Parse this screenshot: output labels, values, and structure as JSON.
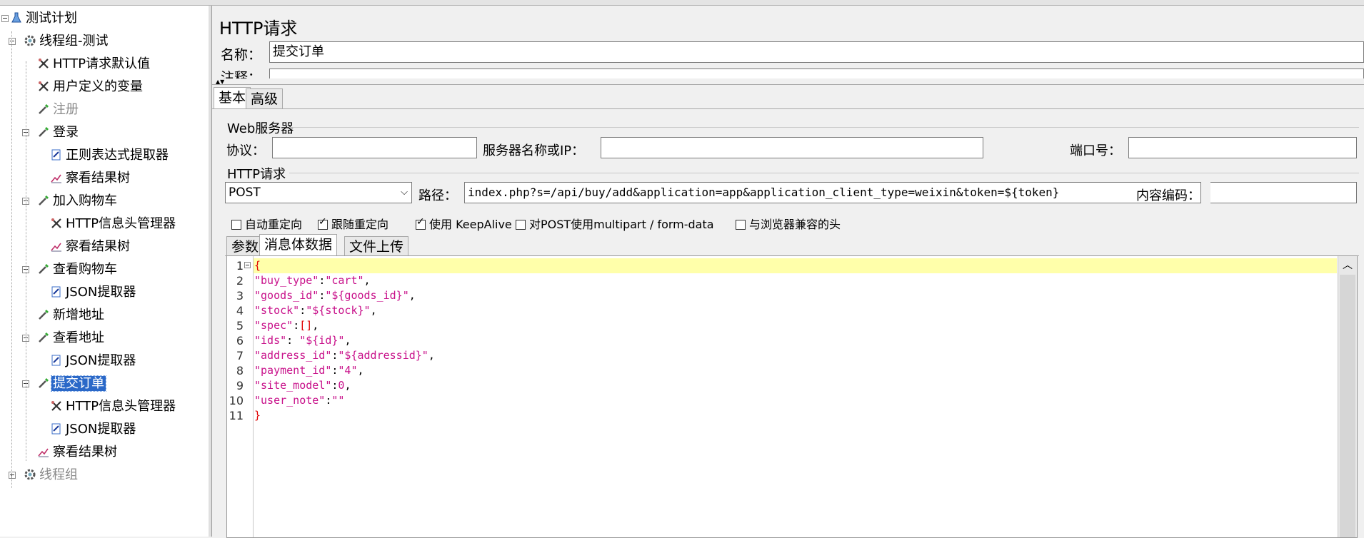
{
  "tree": [
    {
      "label": "测试计划",
      "icon": "flask-icon",
      "level": 0,
      "state": "expanded"
    },
    {
      "label": "线程组-测试",
      "icon": "gear-icon",
      "level": 1,
      "state": "expanded"
    },
    {
      "label": "HTTP请求默认值",
      "icon": "wrench-icon",
      "level": 2
    },
    {
      "label": "用户定义的变量",
      "icon": "wrench-icon",
      "level": 2
    },
    {
      "label": "注册",
      "icon": "pipette-icon",
      "level": 2,
      "disabled": true
    },
    {
      "label": "登录",
      "icon": "pipette-icon",
      "level": 2,
      "state": "expanded"
    },
    {
      "label": "正则表达式提取器",
      "icon": "extractor-icon",
      "level": 3
    },
    {
      "label": "察看结果树",
      "icon": "chart-icon",
      "level": 3
    },
    {
      "label": "加入购物车",
      "icon": "pipette-icon",
      "level": 2,
      "state": "expanded"
    },
    {
      "label": "HTTP信息头管理器",
      "icon": "wrench-icon",
      "level": 3
    },
    {
      "label": "察看结果树",
      "icon": "chart-icon",
      "level": 3
    },
    {
      "label": "查看购物车",
      "icon": "pipette-icon",
      "level": 2,
      "state": "expanded"
    },
    {
      "label": "JSON提取器",
      "icon": "extractor-icon",
      "level": 3
    },
    {
      "label": "新增地址",
      "icon": "pipette-icon",
      "level": 2
    },
    {
      "label": "查看地址",
      "icon": "pipette-icon",
      "level": 2,
      "state": "expanded"
    },
    {
      "label": "JSON提取器",
      "icon": "extractor-icon",
      "level": 3
    },
    {
      "label": "提交订单",
      "icon": "pipette-icon",
      "level": 2,
      "state": "expanded",
      "selected": true
    },
    {
      "label": "HTTP信息头管理器",
      "icon": "wrench-icon",
      "level": 3
    },
    {
      "label": "JSON提取器",
      "icon": "extractor-icon",
      "level": 3
    },
    {
      "label": "察看结果树",
      "icon": "chart-icon",
      "level": 2
    },
    {
      "label": "线程组",
      "icon": "gear-icon",
      "level": 1,
      "state": "collapsed",
      "disabled": true
    }
  ],
  "panel": {
    "title": "HTTP请求",
    "name_label": "名称：",
    "name_value": "提交订单",
    "comment_label": "注释：",
    "main_tabs": [
      "基本",
      "高级"
    ],
    "web_server": {
      "legend": "Web服务器",
      "protocol_label": "协议：",
      "protocol_value": "",
      "server_label": "服务器名称或IP：",
      "server_value": "",
      "port_label": "端口号：",
      "port_value": ""
    },
    "http_request": {
      "legend": "HTTP请求",
      "method": "POST",
      "path_label": "路径：",
      "path_value": "index.php?s=/api/buy/add&application=app&application_client_type=weixin&token=${token}",
      "encoding_label": "内容编码：",
      "encoding_value": ""
    },
    "options": [
      {
        "label": "自动重定向",
        "checked": false
      },
      {
        "label": "跟随重定向",
        "checked": true
      },
      {
        "label": "使用 KeepAlive",
        "checked": true
      },
      {
        "label": "对POST使用multipart / form-data",
        "checked": false
      },
      {
        "label": "与浏览器兼容的头",
        "checked": false
      }
    ],
    "sub_tabs": [
      "参数",
      "消息体数据",
      "文件上传"
    ],
    "body_lines": [
      "{",
      "\"buy_type\":\"cart\",",
      "\"goods_id\":\"${goods_id}\",",
      "\"stock\":\"${stock}\",",
      "\"spec\":[],",
      "\"ids\": \"${id}\",",
      "\"address_id\":\"${addressid}\",",
      "\"payment_id\":\"4\",",
      "\"site_model\":0,",
      "\"user_note\":\"\"",
      "}"
    ]
  }
}
